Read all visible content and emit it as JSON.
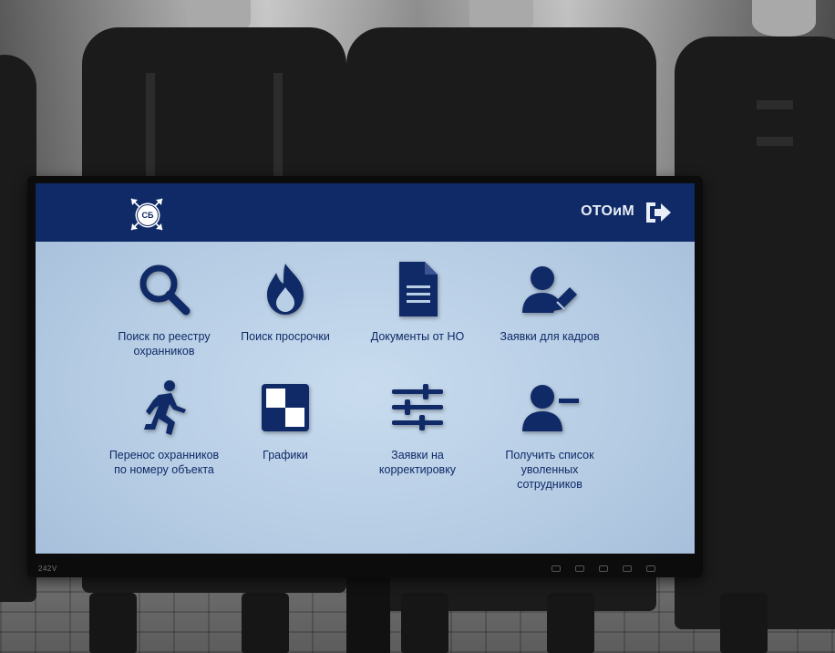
{
  "app": {
    "logo_text": "СБ",
    "user_name": "ОТОиМ"
  },
  "menu": [
    {
      "label": "Поиск по реестру\nохранников",
      "icon": "search-icon"
    },
    {
      "label": "Поиск просрочки",
      "icon": "fire-icon"
    },
    {
      "label": "Документы от НО",
      "icon": "document-icon"
    },
    {
      "label": "Заявки для кадров",
      "icon": "user-edit-icon"
    },
    {
      "label": "Перенос охранников\nпо номеру объекта",
      "icon": "running-person-icon"
    },
    {
      "label": "Графики",
      "icon": "chart-grid-icon"
    },
    {
      "label": "Заявки на\nкорректировку",
      "icon": "sliders-icon"
    },
    {
      "label": "Получить список\nуволенных\nсотрудников",
      "icon": "user-minus-icon"
    }
  ],
  "monitor": {
    "model_label": "242V"
  },
  "colors": {
    "brand_navy": "#0f2a66",
    "screen_bg": "#b9cfe6"
  }
}
